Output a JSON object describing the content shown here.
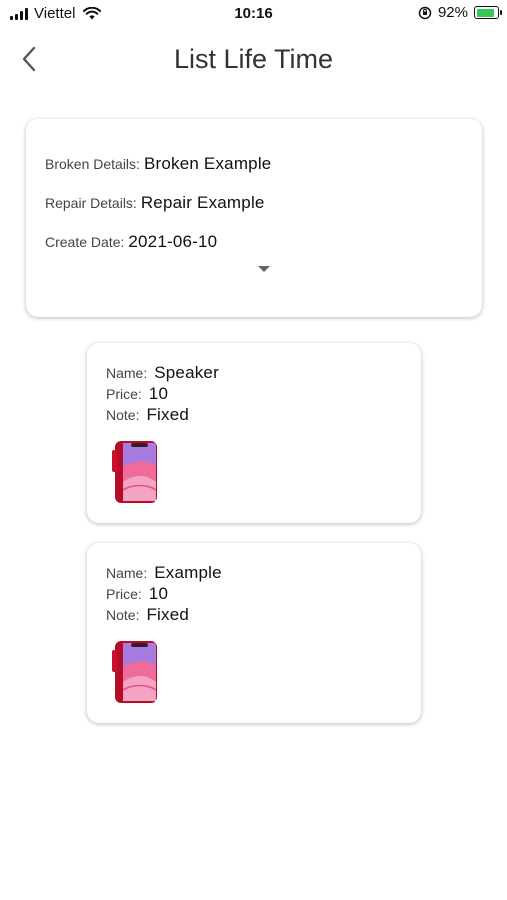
{
  "status_bar": {
    "carrier": "Viettel",
    "time": "10:16",
    "battery_percent": "92%"
  },
  "header": {
    "title": "List Life Time",
    "back_icon": "chevron-left-icon"
  },
  "details": {
    "broken_label": "Broken Details:",
    "broken_value": "Broken Example",
    "repair_label": "Repair Details:",
    "repair_value": "Repair Example",
    "date_label": "Create Date:",
    "date_value": "2021-06-10",
    "expand_icon": "caret-down-icon"
  },
  "items": [
    {
      "name_label": "Name:",
      "name": "Speaker",
      "price_label": "Price:",
      "price": "10",
      "note_label": "Note:",
      "note": "Fixed"
    },
    {
      "name_label": "Name:",
      "name": "Example",
      "price_label": "Price:",
      "price": "10",
      "note_label": "Note:",
      "note": "Fixed"
    }
  ],
  "colors": {
    "phone_body": "#c8102e",
    "phone_screen": "#f06a9a",
    "phone_screen_top": "#a77be0",
    "battery_fill": "#34c759"
  }
}
